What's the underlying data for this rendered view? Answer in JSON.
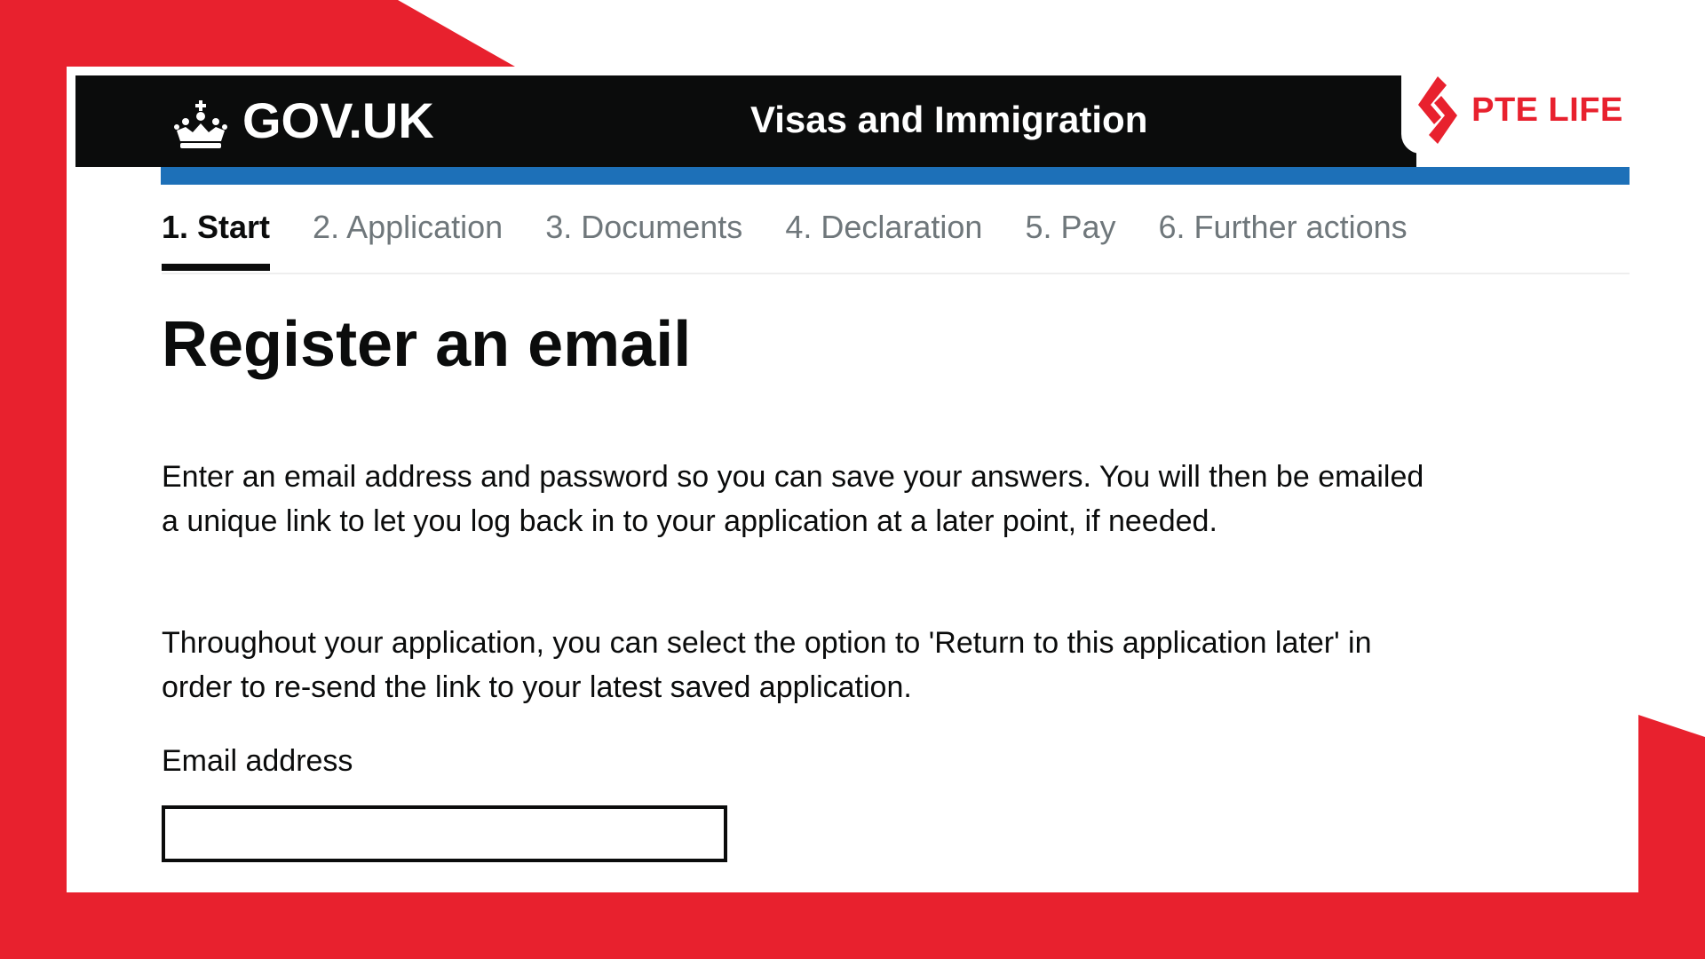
{
  "colors": {
    "accent_red": "#e8212e",
    "header_black": "#0b0c0c",
    "govuk_blue": "#1d70b8"
  },
  "header": {
    "logo_text": "GOV.UK",
    "logo_icon": "crown-icon",
    "service_name": "Visas and Immigration"
  },
  "brand": {
    "name": "PTE LIFE",
    "logo_icon": "pte-life-logo-icon"
  },
  "steps": [
    {
      "label": "1. Start",
      "active": true
    },
    {
      "label": "2. Application",
      "active": false
    },
    {
      "label": "3. Documents",
      "active": false
    },
    {
      "label": "4. Declaration",
      "active": false
    },
    {
      "label": "5. Pay",
      "active": false
    },
    {
      "label": "6. Further actions",
      "active": false
    }
  ],
  "main": {
    "title": "Register an email",
    "paragraph_1": "Enter an email address and password so you can save your answers. You will then be emailed a unique link to let you log back in to your application at a later point, if needed.",
    "paragraph_2": "Throughout your application, you can select the option to 'Return to this application later' in order to re-send the link to your latest saved application.",
    "email_label": "Email address",
    "email_value": ""
  }
}
